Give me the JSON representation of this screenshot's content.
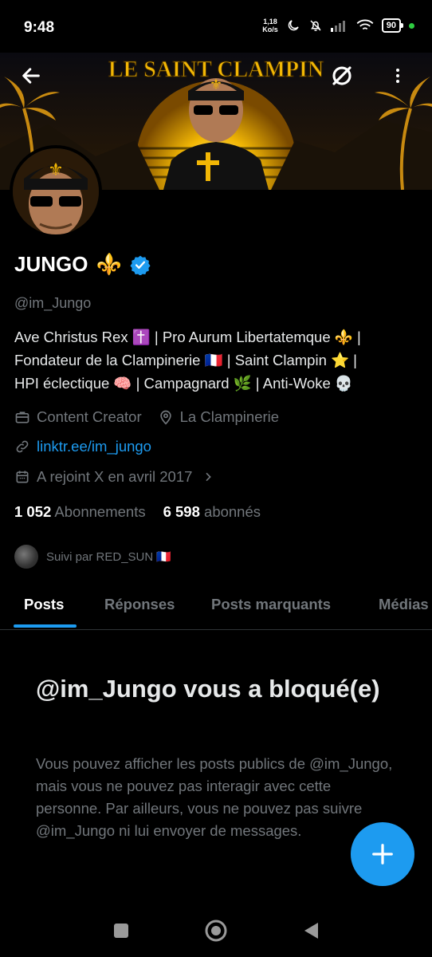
{
  "status_bar": {
    "time": "9:48",
    "net_speed_value": "1,18",
    "net_speed_unit": "Ko/s",
    "battery": "90",
    "icons": [
      "moon-icon",
      "bell-off-icon",
      "signal-icon",
      "wifi-icon"
    ]
  },
  "banner": {
    "title": "LE SAINT CLAMPIN"
  },
  "profile": {
    "name": "JUNGO",
    "name_emoji": "⚜️",
    "handle": "@im_Jungo",
    "bio_lines": [
      "Ave Christus Rex ✝️ | Pro Aurum Libertatemque ⚜️ |",
      "Fondateur de la Clampinerie 🇫🇷 | Saint Clampin ⭐ |",
      "HPI éclectique 🧠 | Campagnard 🌿 | Anti-Woke 💀"
    ],
    "category": "Content Creator",
    "location": "La Clampinerie",
    "link": "linktr.ee/im_jungo",
    "joined": "A rejoint X en avril 2017",
    "following_count": "1 052",
    "following_label": "Abonnements",
    "followers_count": "6 598",
    "followers_label": "abonnés",
    "followed_by": "Suivi par RED_SUN 🇫🇷"
  },
  "tabs": [
    "Posts",
    "Réponses",
    "Posts marquants",
    "Médias"
  ],
  "blocked": {
    "title": "@im_Jungo vous a bloqué(e)",
    "message": "Vous pouvez afficher les posts publics de @im_Jungo, mais vous ne pouvez pas interagir avec cette personne. Par ailleurs, vous ne pouvez pas suivre @im_Jungo ni lui envoyer de messages."
  },
  "colors": {
    "accent": "#1d9bf0",
    "background": "#000000",
    "text": "#e7e9ea",
    "muted": "#71767b",
    "banner_gold": "#f2b705"
  }
}
